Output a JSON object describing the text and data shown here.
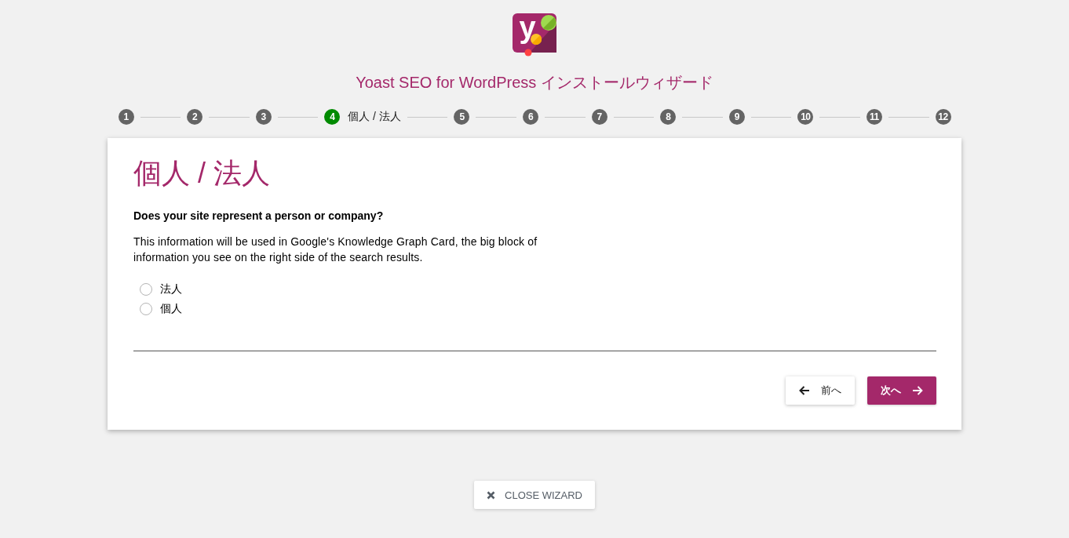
{
  "logo": {
    "letter": "y"
  },
  "title": "Yoast SEO for WordPress インストールウィザード",
  "steps": [
    {
      "number": "1",
      "selected": false
    },
    {
      "number": "2",
      "selected": false
    },
    {
      "number": "3",
      "selected": false
    },
    {
      "number": "4",
      "selected": true,
      "title": "個人 / 法人"
    },
    {
      "number": "5",
      "selected": false
    },
    {
      "number": "6",
      "selected": false
    },
    {
      "number": "7",
      "selected": false
    },
    {
      "number": "8",
      "selected": false
    },
    {
      "number": "9",
      "selected": false
    },
    {
      "number": "10",
      "selected": false
    },
    {
      "number": "11",
      "selected": false
    },
    {
      "number": "12",
      "selected": false
    }
  ],
  "card": {
    "heading": "個人 / 法人",
    "question": "Does your site represent a person or company?",
    "description": "This information will be used in Google's Knowledge Graph Card, the big block of information you see on the right side of the search results.",
    "options": [
      {
        "label": "法人",
        "selected": false
      },
      {
        "label": "個人",
        "selected": false
      }
    ],
    "buttons": [
      {
        "kind": "back",
        "label": "前へ"
      },
      {
        "kind": "next",
        "label": "次へ"
      }
    ]
  },
  "close_button": {
    "label": "CLOSE WIZARD"
  }
}
